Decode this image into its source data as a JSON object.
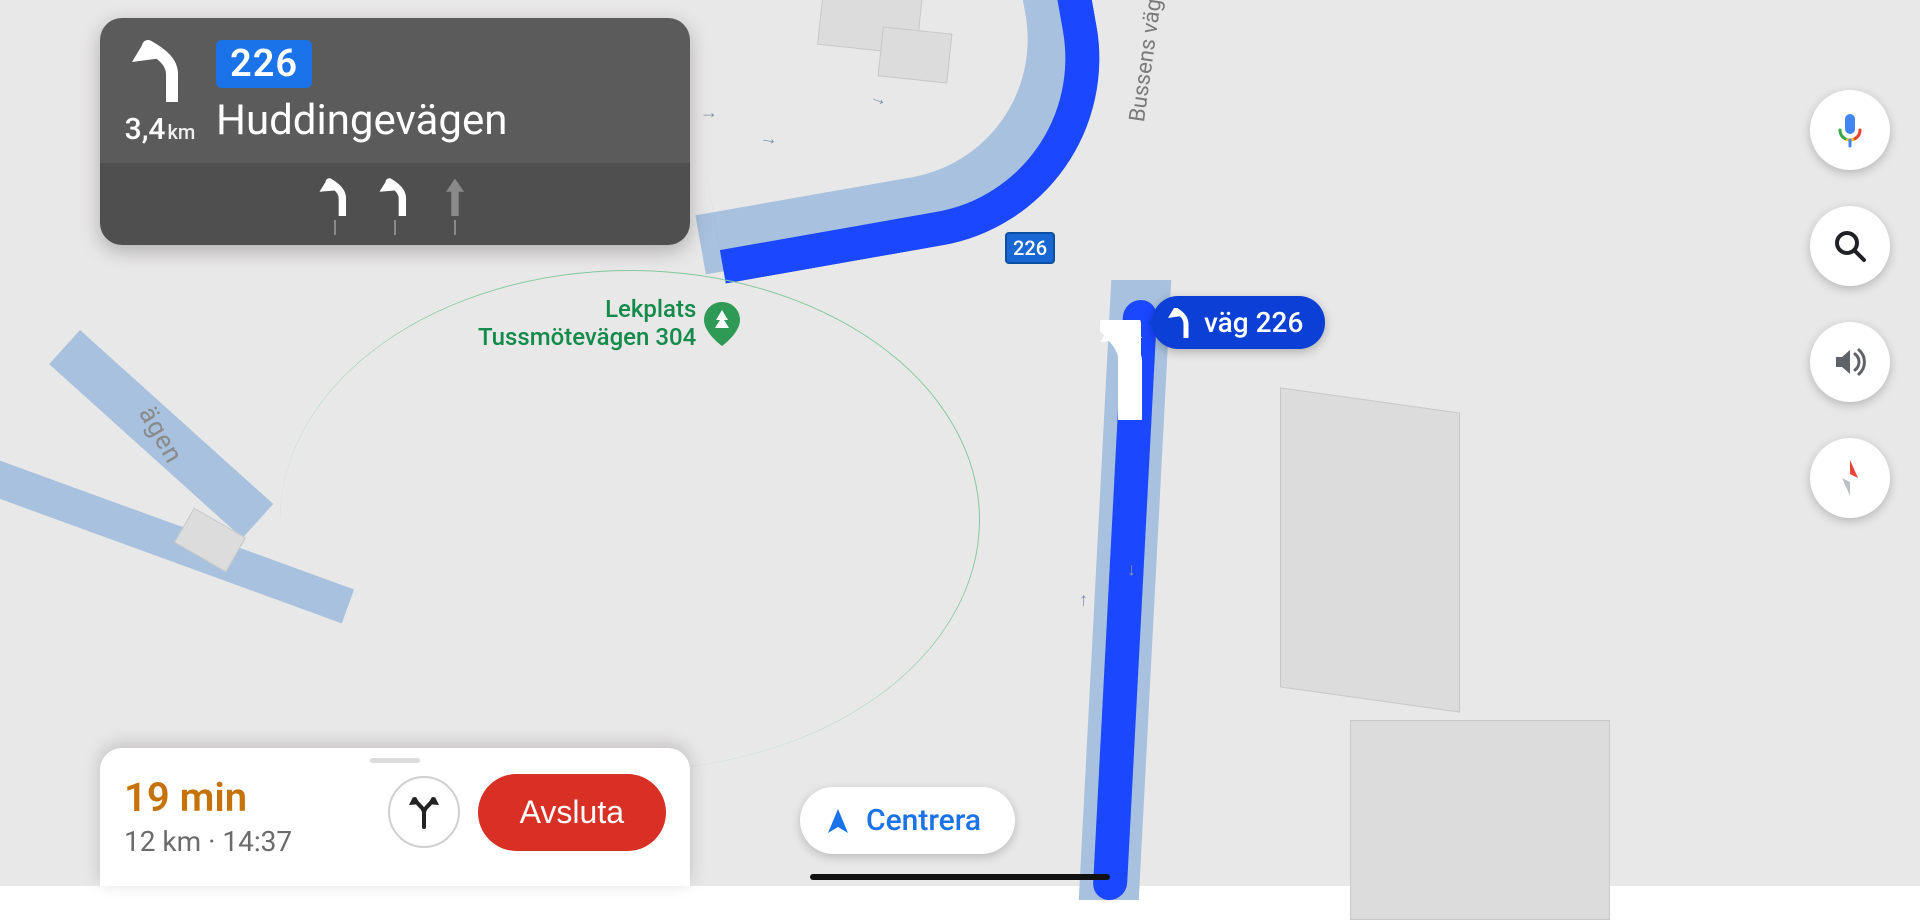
{
  "direction": {
    "distance_value": "3,4",
    "distance_unit": "km",
    "road_number": "226",
    "road_name": "Huddingevägen",
    "lanes": [
      {
        "shape": "fork-left",
        "active": true
      },
      {
        "shape": "fork-left",
        "active": true
      },
      {
        "shape": "straight",
        "active": false
      }
    ]
  },
  "trip": {
    "eta_primary": "19 min",
    "eta_secondary": "12 km · 14:37",
    "end_label": "Avsluta"
  },
  "recenter": {
    "label": "Centrera"
  },
  "map": {
    "poi": {
      "name_line1": "Lekplats",
      "name_line2": "Tussmötevägen 304"
    },
    "road_badge": "226",
    "turn_bubble": "väg 226",
    "street_bussens": "Bussens väg",
    "street_partial": "ägen"
  },
  "colors": {
    "accent_blue": "#1a73e8",
    "route_blue": "#1a47ff",
    "warning_orange": "#c5720a",
    "danger_red": "#d93025",
    "poi_green": "#148a4b"
  }
}
